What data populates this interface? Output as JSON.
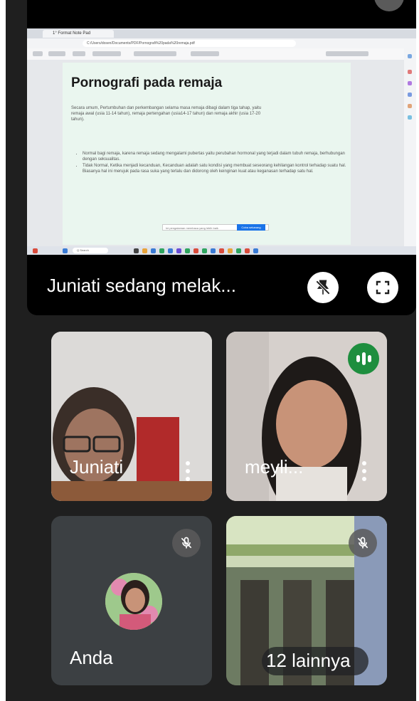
{
  "presentation": {
    "browser_tab_title": "1° Format Note Pad",
    "address_text": "C:/Users/dosen/Documents/PDF/Pornografi%20pada%20remaja.pdf",
    "slide_title": "Pornografi pada remaja",
    "intro_text": "Secara umum, Pertumbuhan dan perkembangan selama masa remaja dibagi dalam tiga tahap, yaitu remaja awal (usia 11-14 tahun), remaja pertengahan (usia14-17 tahun) dan remaja akhir (usia 17-20 tahun).",
    "bullets": [
      "Normal bagi remaja, karena remaja sedang mengalami pubertas yaitu perubahan hormonal yang terjadi dalam tubuh remaja, berhubungan dengan seksualitas.",
      "Tidak Normal, Ketika menjadi kecanduan, Kecanduan adalah satu kondisi yang membuat seseorang kehilangan kontrol terhadap suatu hal. Biasanya hal ini merujuk pada rasa suka yang terlalu dan didorong oleh keinginan kuat atau keganasan terhadap satu hal."
    ],
    "message_text": "Ini pengalaman membaca yang lebih baik",
    "message_button": "Coba sekarang",
    "taskbar_search": "Q Search"
  },
  "presenter": {
    "label": "Juniati sedang melak...",
    "unpin_icon": "pin-off-icon",
    "fullscreen_icon": "fullscreen-icon"
  },
  "participants": [
    {
      "name": "Juniati",
      "more_icon": "more-vert-icon"
    },
    {
      "name": "meyli...",
      "more_icon": "more-vert-icon",
      "speaking_icon": "audio-level-icon",
      "speaking_color": "#1e8e3e"
    },
    {
      "name": "Anda",
      "mic_icon": "mic-off-icon"
    },
    {
      "name": "12 lainnya",
      "mic_icon": "mic-off-icon"
    }
  ],
  "colors": {
    "background": "#1f1f1f",
    "tile": "#3c4043",
    "slide_bg": "#eaf6ef",
    "speaking": "#1e8e3e",
    "accent_blue": "#1a73e8"
  }
}
